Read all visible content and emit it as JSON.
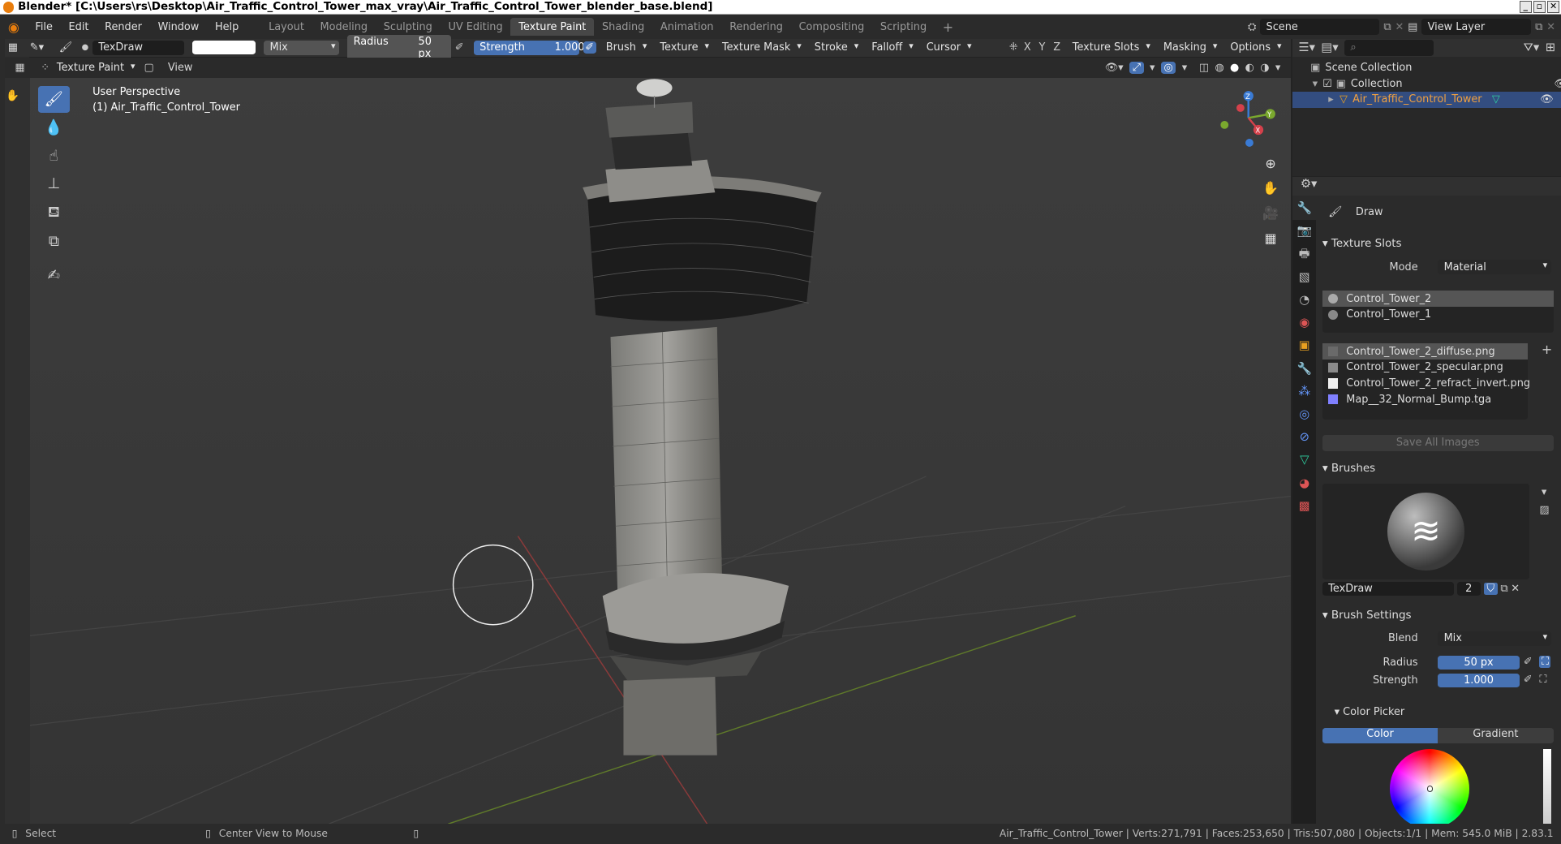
{
  "titlebar": {
    "title": "Blender* [C:\\Users\\rs\\Desktop\\Air_Traffic_Control_Tower_max_vray\\Air_Traffic_Control_Tower_blender_base.blend]"
  },
  "menu": [
    "File",
    "Edit",
    "Render",
    "Window",
    "Help"
  ],
  "workspaces": [
    "Layout",
    "Modeling",
    "Sculpting",
    "UV Editing",
    "Texture Paint",
    "Shading",
    "Animation",
    "Rendering",
    "Compositing",
    "Scripting"
  ],
  "active_workspace": "Texture Paint",
  "scene": {
    "scene_name": "Scene",
    "view_layer": "View Layer"
  },
  "tool_header": {
    "brush_name": "TexDraw",
    "blend": "Mix",
    "radius_label": "Radius",
    "radius_value": "50 px",
    "strength_label": "Strength",
    "strength_value": "1.000",
    "menus": [
      "Brush",
      "Texture",
      "Texture Mask",
      "Stroke",
      "Falloff",
      "Cursor"
    ],
    "axes": [
      "X",
      "Y",
      "Z"
    ],
    "right_menus": [
      "Texture Slots",
      "Masking",
      "Options"
    ]
  },
  "sub_header": {
    "mode": "Texture Paint",
    "view": "View"
  },
  "viewport": {
    "perspective": "User Perspective",
    "object_label": "(1) Air_Traffic_Control_Tower",
    "gizmo_axes": [
      "Z",
      "Y",
      "X"
    ]
  },
  "outliner": {
    "root": "Scene Collection",
    "collection": "Collection",
    "object": "Air_Traffic_Control_Tower"
  },
  "properties": {
    "tool_name": "Draw",
    "texture_slots": {
      "title": "Texture Slots",
      "mode_label": "Mode",
      "mode_value": "Material",
      "materials": [
        "Control_Tower_2",
        "Control_Tower_1"
      ],
      "images": [
        {
          "name": "Control_Tower_2_diffuse.png",
          "color": "#6a6a6a"
        },
        {
          "name": "Control_Tower_2_specular.png",
          "color": "#8a8a8a"
        },
        {
          "name": "Control_Tower_2_refract_invert.png",
          "color": "#f0f0f0"
        },
        {
          "name": "Map__32_Normal_Bump.tga",
          "color": "#8080ff"
        }
      ],
      "save_all": "Save All Images"
    },
    "brushes": {
      "title": "Brushes",
      "brush_name": "TexDraw",
      "users": "2"
    },
    "brush_settings": {
      "title": "Brush Settings",
      "blend_label": "Blend",
      "blend_value": "Mix",
      "radius_label": "Radius",
      "radius_value": "50 px",
      "strength_label": "Strength",
      "strength_value": "1.000"
    },
    "color_picker": {
      "title": "Color Picker",
      "tab_color": "Color",
      "tab_gradient": "Gradient"
    }
  },
  "statusbar": {
    "select": "Select",
    "center_view": "Center View to Mouse",
    "stats": "Air_Traffic_Control_Tower | Verts:271,791 | Faces:253,650 | Tris:507,080 | Objects:1/1 | Mem: 545.0 MiB | 2.83.1"
  },
  "colors": {
    "accent": "#4772b3",
    "header": "#303030",
    "viewport": "#393939"
  }
}
